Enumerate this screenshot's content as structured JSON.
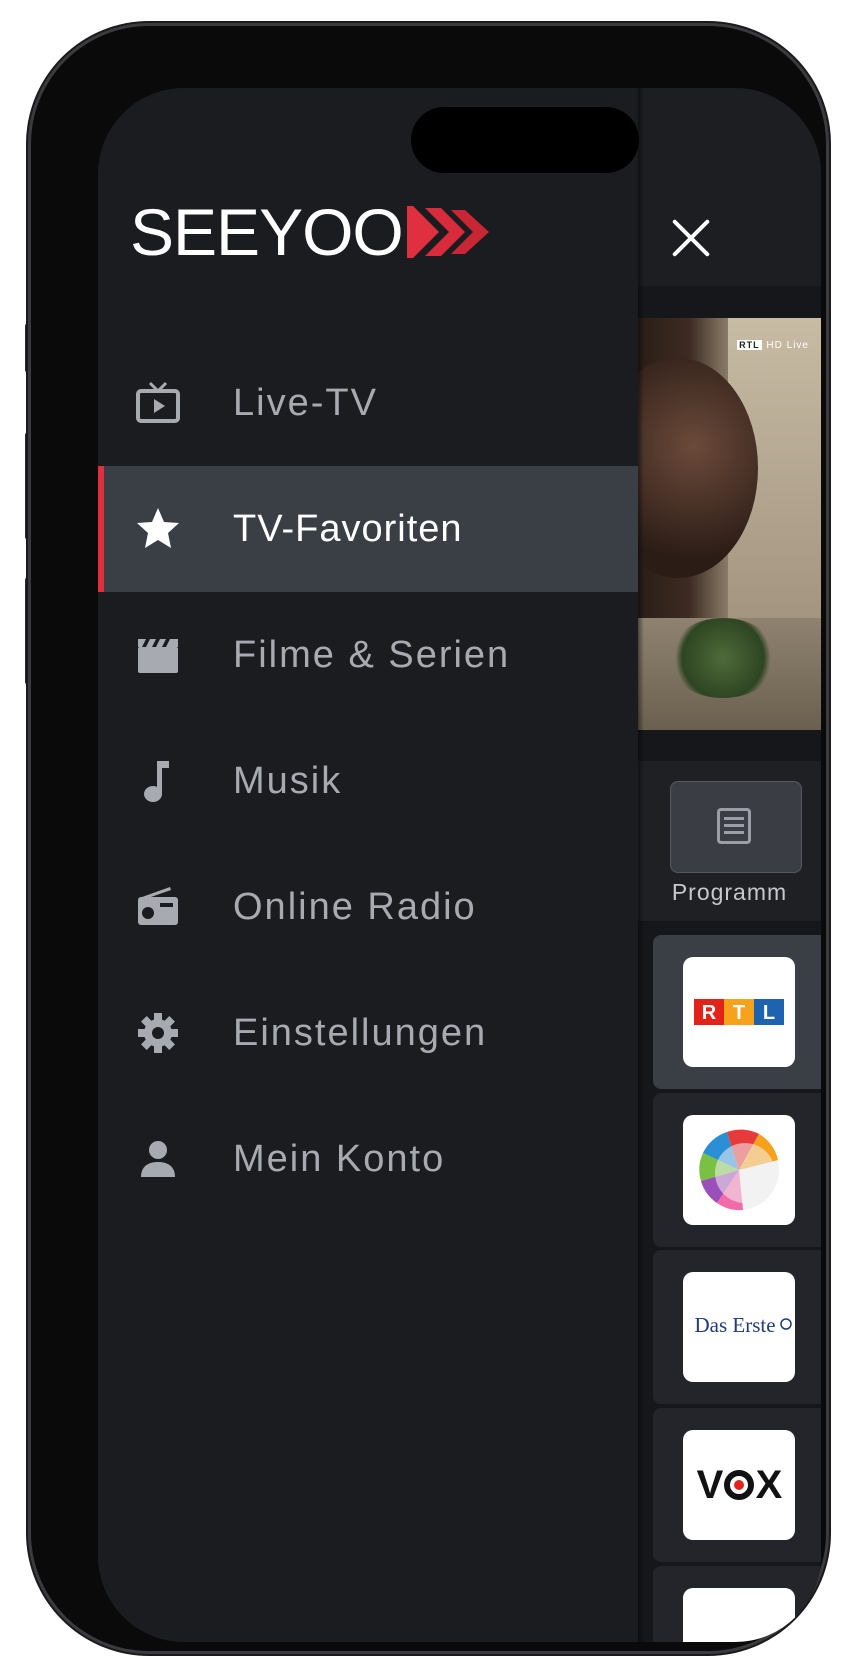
{
  "drawer": {
    "logo_text": "SEEYOO",
    "accent_color": "#e0303f",
    "menu": [
      {
        "label": "Live-TV",
        "icon": "tv-icon",
        "active": false
      },
      {
        "label": "TV-Favoriten",
        "icon": "star-icon",
        "active": true
      },
      {
        "label": "Filme & Serien",
        "icon": "clapperboard-icon",
        "active": false
      },
      {
        "label": "Musik",
        "icon": "music-note-icon",
        "active": false
      },
      {
        "label": "Online Radio",
        "icon": "radio-icon",
        "active": false
      },
      {
        "label": "Einstellungen",
        "icon": "gear-icon",
        "active": false
      },
      {
        "label": "Mein Konto",
        "icon": "user-icon",
        "active": false
      }
    ]
  },
  "background": {
    "close_icon": "close-icon",
    "video_watermark": {
      "brand": "RTL",
      "suffix": "HD Live"
    },
    "program_button_label": "Programm",
    "channels": [
      {
        "name": "RTL",
        "active": true
      },
      {
        "name": "SAT.1",
        "active": false
      },
      {
        "name": "Das Erste",
        "active": false
      },
      {
        "name": "VOX",
        "active": false
      }
    ]
  }
}
